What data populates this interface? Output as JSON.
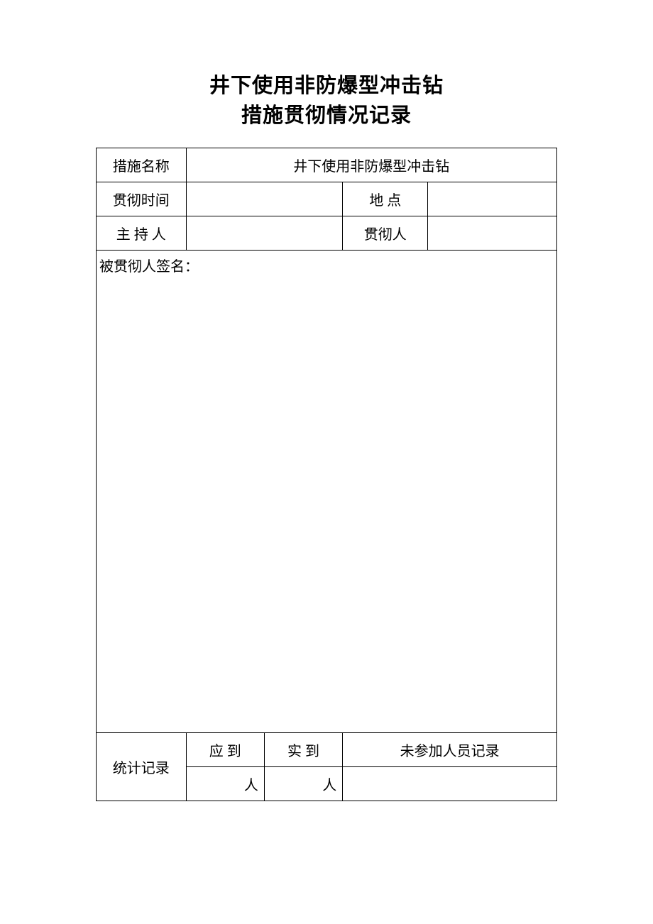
{
  "title_line1": "井下使用非防爆型冲击钻",
  "title_line2": "措施贯彻情况记录",
  "labels": {
    "measure_name": "措施名称",
    "measure_value": "井下使用非防爆型冲击钻",
    "impl_time": "贯彻时间",
    "location": "地  点",
    "host": "主 持 人",
    "implementer": "贯彻人",
    "signature_label": "被贯彻人签名：",
    "stats_label": "统计记录",
    "expected": "应 到",
    "actual": "实 到",
    "absent": "未参加人员记录",
    "person_unit": "人"
  },
  "values": {
    "impl_time": "",
    "location": "",
    "host": "",
    "implementer": "",
    "signatures": "",
    "expected_count": "",
    "actual_count": "",
    "absent_record": ""
  }
}
